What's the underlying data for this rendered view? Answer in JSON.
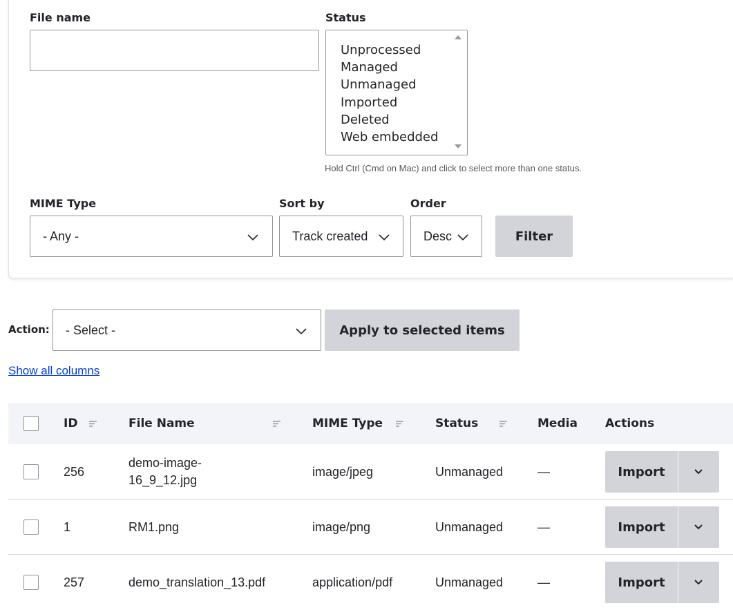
{
  "filters": {
    "file_name_label": "File name",
    "file_name_value": "",
    "status_label": "Status",
    "status_options": [
      "Unprocessed",
      "Managed",
      "Unmanaged",
      "Imported",
      "Deleted",
      "Web embedded"
    ],
    "status_help": "Hold Ctrl (Cmd on Mac) and click to select more than one status.",
    "mime_label": "MIME Type",
    "mime_value": "- Any -",
    "sort_label": "Sort by",
    "sort_value": "Track created",
    "order_label": "Order",
    "order_value": "Desc",
    "filter_button": "Filter"
  },
  "bulk": {
    "action_label": "Action:",
    "action_value": "- Select -",
    "apply_button": "Apply to selected items"
  },
  "show_all_columns": "Show all columns",
  "table": {
    "headers": {
      "id": "ID",
      "file_name": "File Name",
      "mime": "MIME Type",
      "status": "Status",
      "media": "Media",
      "actions": "Actions"
    },
    "rows": [
      {
        "id": "256",
        "file_name_line1": "demo-image-",
        "file_name_line2": "16_9_12.jpg",
        "mime": "image/jpeg",
        "status": "Unmanaged",
        "media": "—",
        "action": "Import"
      },
      {
        "id": "1",
        "file_name_line1": "RM1.png",
        "file_name_line2": "",
        "mime": "image/png",
        "status": "Unmanaged",
        "media": "—",
        "action": "Import"
      },
      {
        "id": "257",
        "file_name_line1": "demo_translation_13.pdf",
        "file_name_line2": "",
        "mime": "application/pdf",
        "status": "Unmanaged",
        "media": "—",
        "action": "Import"
      }
    ]
  },
  "colors": {
    "button_bg": "#d3d4d9",
    "header_bg": "#f3f4f9",
    "link": "#003ecc",
    "border": "#919297"
  }
}
